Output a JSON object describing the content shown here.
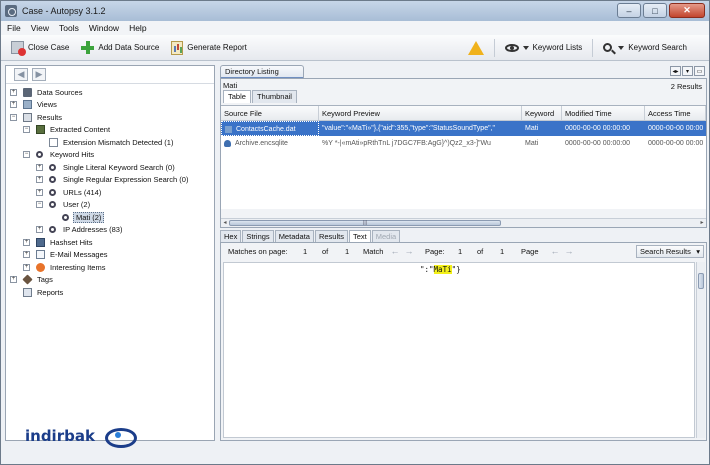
{
  "window": {
    "title": "Case - Autopsy 3.1.2",
    "controls": [
      "–",
      "□",
      "✕"
    ]
  },
  "menu": [
    "File",
    "View",
    "Tools",
    "Window",
    "Help"
  ],
  "toolbar": {
    "close_case": "Close Case",
    "add_data_source": "Add Data Source",
    "generate_report": "Generate Report",
    "keyword_lists": "Keyword Lists",
    "keyword_search": "Keyword Search"
  },
  "tree": [
    {
      "label": "Data Sources",
      "icon": "database-icon",
      "level": 0,
      "toggle": "+"
    },
    {
      "label": "Views",
      "icon": "views-icon",
      "level": 0,
      "toggle": "+"
    },
    {
      "label": "Results",
      "icon": "results-icon",
      "level": 0,
      "toggle": "−"
    },
    {
      "label": "Extracted Content",
      "icon": "extracted-content-icon",
      "level": 1,
      "toggle": "−"
    },
    {
      "label": "Extension Mismatch Detected (1)",
      "icon": "document-icon",
      "level": 2,
      "toggle": ""
    },
    {
      "label": "Keyword Hits",
      "icon": "search-icon",
      "level": 1,
      "toggle": "−"
    },
    {
      "label": "Single Literal Keyword Search (0)",
      "icon": "search-icon",
      "level": 2,
      "toggle": "+"
    },
    {
      "label": "Single Regular Expression Search (0)",
      "icon": "search-icon",
      "level": 2,
      "toggle": "+"
    },
    {
      "label": "URLs (414)",
      "icon": "search-icon",
      "level": 2,
      "toggle": "+"
    },
    {
      "label": "User (2)",
      "icon": "search-icon",
      "level": 2,
      "toggle": "−"
    },
    {
      "label": "Mati (2)",
      "icon": "search-icon",
      "level": 3,
      "toggle": "",
      "selected": true
    },
    {
      "label": "IP Addresses (83)",
      "icon": "search-icon",
      "level": 2,
      "toggle": "+"
    },
    {
      "label": "Hashset Hits",
      "icon": "hashset-icon",
      "level": 1,
      "toggle": "+"
    },
    {
      "label": "E-Mail Messages",
      "icon": "email-icon",
      "level": 1,
      "toggle": "+"
    },
    {
      "label": "Interesting Items",
      "icon": "interesting-items-icon",
      "level": 1,
      "toggle": "+"
    },
    {
      "label": "Tags",
      "icon": "tag-icon",
      "level": 0,
      "toggle": "+"
    },
    {
      "label": "Reports",
      "icon": "report-icon",
      "level": 0,
      "toggle": ""
    }
  ],
  "directory": {
    "tab": "Directory Listing",
    "keyword": "Mati",
    "result_count": "2 Results",
    "subtabs": [
      "Table",
      "Thumbnail"
    ],
    "columns": [
      "Source File",
      "Keyword Preview",
      "Keyword",
      "Modified Time",
      "Access Time"
    ],
    "rows": [
      {
        "file": "ContactsCache.dat",
        "preview": "\"value\":\"«MaTi»\"},{\"aid\":355,\"type\":\"StatusSoundType\",\"",
        "keyword": "Mati",
        "modified": "0000-00-00 00:00:00",
        "access": "0000-00-00 00:00",
        "selected": true
      },
      {
        "file": "Archive.encsqlite",
        "preview": "%Y     *-|«mAti»pRthTnL j7DGC7FB:AgG}^)Qz2_x3-]\"Wu",
        "keyword": "Mati",
        "modified": "0000-00-00 00:00:00",
        "access": "0000-00-00 00:00",
        "selected": false
      }
    ]
  },
  "content": {
    "tabs": [
      "Hex",
      "Strings",
      "Metadata",
      "Results",
      "Text",
      "Media"
    ],
    "matches_label": "Matches on page:",
    "match_current": "1",
    "of1": "of",
    "match_total": "1",
    "match_word": "Match",
    "page_label": "Page:",
    "page_current": "1",
    "of2": "of",
    "page_total": "1",
    "page_word": "Page",
    "search_results": "Search Results",
    "hit_prefix": "\":\"",
    "hit_word": "MaTi",
    "hit_suffix": "\"}"
  },
  "logo": "indirbak"
}
